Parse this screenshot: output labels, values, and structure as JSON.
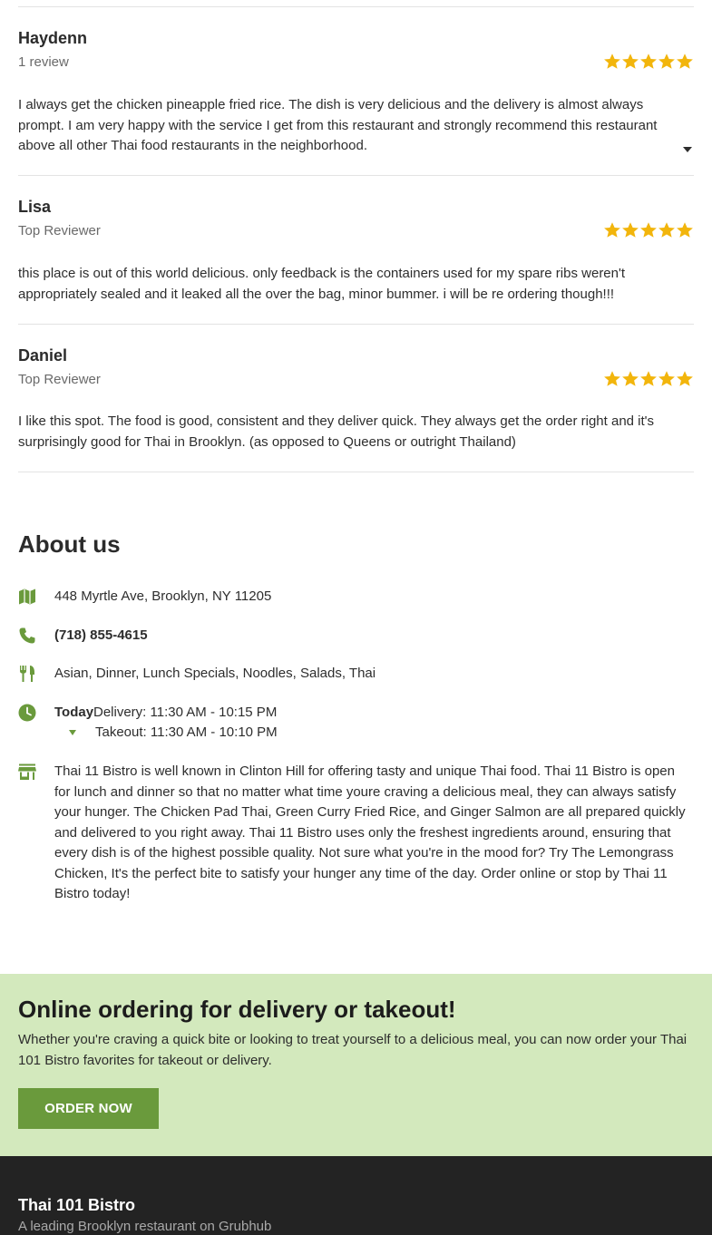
{
  "reviews": [
    {
      "name": "Haydenn",
      "subtitle": "1 review",
      "rating": 5,
      "text": "I always get the chicken pineapple fried rice. The dish is very delicious and the delivery is almost always prompt. I am very happy with the service I get from this restaurant and strongly recommend this restaurant above all other Thai food restaurants in the neighborhood.",
      "expandable": true
    },
    {
      "name": "Lisa",
      "subtitle": "Top Reviewer",
      "rating": 5,
      "text": "this place is out of this world delicious. only feedback is the containers used for my spare ribs weren't appropriately sealed and it leaked all the over the bag, minor bummer. i will be re ordering though!!!",
      "expandable": false
    },
    {
      "name": "Daniel",
      "subtitle": "Top Reviewer",
      "rating": 5,
      "text": "I like this spot. The food is good, consistent and they deliver quick. They always get the order right and it's surprisingly good for Thai in Brooklyn. (as opposed to Queens or outright Thailand)",
      "expandable": false
    }
  ],
  "about": {
    "title": "About us",
    "address": "448 Myrtle Ave, Brooklyn, NY 11205",
    "phone": "(718) 855-4615",
    "cuisines": "Asian, Dinner, Lunch Specials, Noodles, Salads, Thai",
    "hours": {
      "day_label": "Today",
      "delivery": "Delivery: 11:30 AM - 10:15 PM",
      "takeout": "Takeout: 11:30 AM - 10:10 PM"
    },
    "description": "Thai 11 Bistro is well known in Clinton Hill for offering tasty and unique Thai food. Thai 11 Bistro is open for lunch and dinner so that no matter what time youre craving a delicious meal, they can always satisfy your hunger. The Chicken Pad Thai, Green Curry Fried Rice, and Ginger Salmon are all prepared quickly and delivered to you right away. Thai 11 Bistro uses only the freshest ingredients around, ensuring that every dish is of the highest possible quality. Not sure what you're in the mood for? Try The Lemongrass Chicken, It's the perfect bite to satisfy your hunger any time of the day. Order online or stop by Thai 11 Bistro today!"
  },
  "promo": {
    "title": "Online ordering for delivery or takeout!",
    "text": "Whether you're craving a quick bite or looking to treat yourself to a delicious meal, you can now order your Thai 101 Bistro favorites for takeout or delivery.",
    "button_label": "ORDER NOW"
  },
  "footer": {
    "name": "Thai 101 Bistro",
    "tagline": "A leading Brooklyn restaurant on Grubhub"
  },
  "colors": {
    "accent": "#6a9a3c",
    "star": "#f2b50c",
    "promo_bg": "#d3e9bd",
    "footer_bg": "#232323"
  },
  "icons": [
    "star-icon",
    "map-icon",
    "phone-icon",
    "utensils-icon",
    "clock-icon",
    "store-icon",
    "caret-down-icon"
  ]
}
